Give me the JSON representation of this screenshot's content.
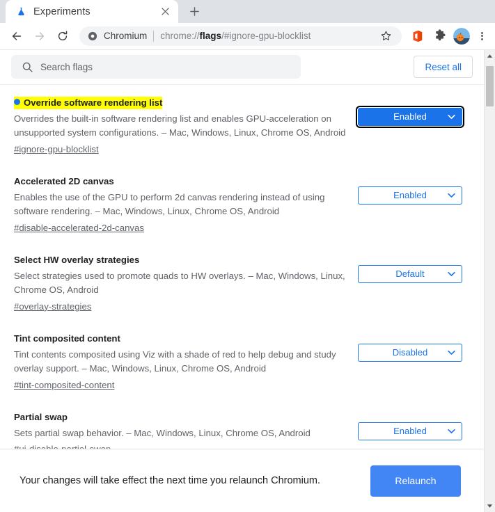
{
  "window": {
    "tab": {
      "title": "Experiments",
      "favicon": "flask-icon",
      "close_label": "×"
    },
    "newtab_label": "+",
    "toolbar": {
      "back": "back-arrow",
      "forward": "forward-arrow",
      "reload": "reload-arrow",
      "origin": "Chromium",
      "url_prefix": "chrome://",
      "url_bold": "flags",
      "url_suffix": "/#ignore-gpu-blocklist",
      "url_full": "chrome://flags/#ignore-gpu-blocklist",
      "star": "bookmark-star-icon",
      "office_ext": "office-extension-icon",
      "extensions": "puzzle-piece-icon",
      "avatar": "profile-avatar",
      "menu": "three-dot-menu-icon"
    }
  },
  "search": {
    "placeholder": "Search flags",
    "value": "",
    "icon": "search-icon"
  },
  "reset_all_label": "Reset all",
  "flags": [
    {
      "title": "Override software rendering list",
      "highlighted": true,
      "has_dot": true,
      "description": "Overrides the built-in software rendering list and enables GPU-acceleration on unsupported system configurations. – Mac, Windows, Linux, Chrome OS, Android",
      "anchor": "#ignore-gpu-blocklist",
      "select_value": "Enabled",
      "focused": true
    },
    {
      "title": "Accelerated 2D canvas",
      "highlighted": false,
      "has_dot": false,
      "description": "Enables the use of the GPU to perform 2d canvas rendering instead of using software rendering. – Mac, Windows, Linux, Chrome OS, Android",
      "anchor": "#disable-accelerated-2d-canvas",
      "select_value": "Enabled",
      "focused": false
    },
    {
      "title": "Select HW overlay strategies",
      "highlighted": false,
      "has_dot": false,
      "description": "Select strategies used to promote quads to HW overlays. – Mac, Windows, Linux, Chrome OS, Android",
      "anchor": "#overlay-strategies",
      "select_value": "Default",
      "focused": false
    },
    {
      "title": "Tint composited content",
      "highlighted": false,
      "has_dot": false,
      "description": "Tint contents composited using Viz with a shade of red to help debug and study overlay support. – Mac, Windows, Linux, Chrome OS, Android",
      "anchor": "#tint-composited-content",
      "select_value": "Disabled",
      "focused": false
    },
    {
      "title": "Partial swap",
      "highlighted": false,
      "has_dot": false,
      "description": "Sets partial swap behavior. – Mac, Windows, Linux, Chrome OS, Android",
      "anchor": "#ui-disable-partial-swap",
      "select_value": "Enabled",
      "focused": false
    }
  ],
  "relaunch": {
    "message": "Your changes will take effect the next time you relaunch Chromium.",
    "button_label": "Relaunch"
  },
  "colors": {
    "accent_blue": "#1a73e8",
    "relaunch_blue": "#4285f4",
    "highlight_yellow": "#ffff00",
    "tabstrip_gray": "#dee1e6",
    "field_gray": "#f1f3f4"
  }
}
